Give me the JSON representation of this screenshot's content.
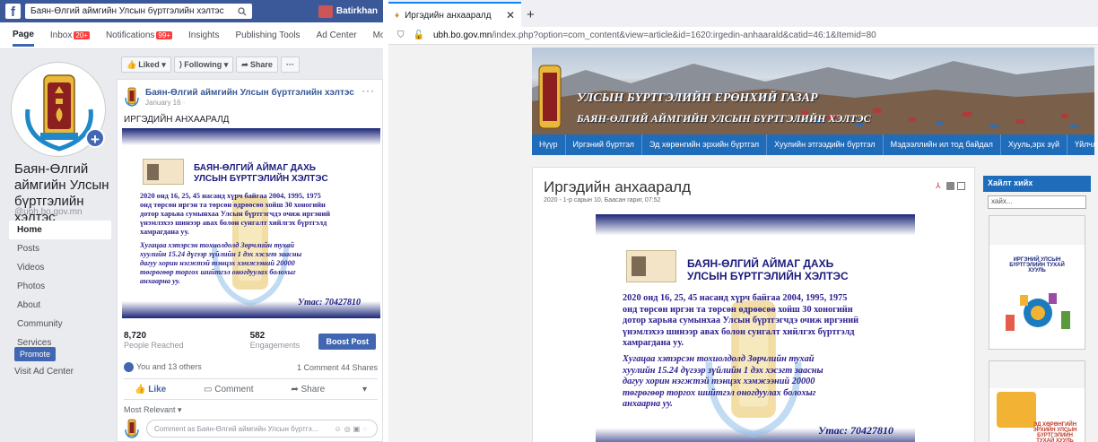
{
  "facebook": {
    "search": "Баян-Өлгий аймгийн Улсын бүртгэлийн хэлтэс",
    "user": "Batirkhan",
    "nav": [
      {
        "label": "Page"
      },
      {
        "label": "Inbox",
        "badge": "20+"
      },
      {
        "label": "Notifications",
        "badge": "99+"
      },
      {
        "label": "Insights"
      },
      {
        "label": "Publishing Tools"
      },
      {
        "label": "Ad Center"
      },
      {
        "label": "More ▾"
      }
    ],
    "page_name": "Баян-Өлгий аймгийн Улсын бүртгэлийн хэлтэс",
    "handle": "@ubh.bo.gov.mn",
    "menu": [
      "Home",
      "Posts",
      "Videos",
      "Photos",
      "About",
      "Community",
      "Services"
    ],
    "promote": "Promote",
    "visit": "Visit Ad Center",
    "actions": [
      "Liked ▾",
      "Following ▾",
      "Share",
      "···"
    ],
    "post": {
      "author": "Баян-Өлгий аймгийн Улсын бүртгэлийн хэлтэс",
      "date": "January 16 ·",
      "text": "ИРГЭДИЙН АНХААРАЛД",
      "reached": "8,720",
      "reached_label": "People Reached",
      "engagements": "582",
      "engagements_label": "Engagements",
      "boost": "Boost Post",
      "reactions": "You and 13 others",
      "comments": "1 Comment 44 Shares",
      "like": "Like",
      "comment": "Comment",
      "share": "Share",
      "most_relevant": "Most Relevant ▾",
      "comment_placeholder": "Comment as Баян-Өлгий аймгийн Улсын бүртгэ..."
    }
  },
  "banner": {
    "title1": "БАЯН-ӨЛГИЙ АЙМАГ ДАХЬ",
    "title2": "УЛСЫН БҮРТГЭЛИЙН ХЭЛТЭС",
    "body": [
      "2020 онд 16, 25, 45 насанд хүрч байгаа 2004, 1995, 1975",
      "онд төрсөн иргэн та төрсөн өдрөөсөө хойш 30 хоногийн",
      "дотор харьяа сумынхаа Улсын бүртгэгчдэ очиж иргэний",
      "үнэмлэхээ шинээр авах болон сунгалт хийлгэх бүртгэлд",
      "хамрагдана уу."
    ],
    "italic": [
      "Хугацаа хэтэрсэн тохиолдолд Зөрчлийн тухай",
      "хуулийн 15.24 дүгээр зүйлийн 1 дэх хэсэгт заасны",
      "дагуу хорин нэгжтэй тэнцэх хэмжээний 20000",
      "төгрөгөөр торгох шийтгэл оногдуулах болохыг",
      "анхаарна уу."
    ],
    "phone": "Утас: 70427810"
  },
  "browser": {
    "tab_title": "Иргэдийн анхааралд",
    "url_domain": "ubh.bo.gov.mn",
    "url_path": "/index.php?option=com_content&view=article&id=1620:irgedin-anhaarald&catid=46:1&Itemid=80",
    "header1": "УЛСЫН БҮРТГЭЛИЙН ЕРӨНХИЙ ГАЗАР",
    "header2": "БАЯН-ӨЛГИЙ АЙМГИЙН УЛСЫН БҮРТГЭЛИЙН ХЭЛТЭС",
    "nav": [
      "Нүүр",
      "Иргэний бүртгэл",
      "Эд хөрөнгийн эрхийн бүртгэл",
      "Хуулийн этгээдийн бүртгэл",
      "Мэдээллийн ил тод байдал",
      "Хууль,эрх зүй",
      "Үйлчлүүлэгчид танд"
    ],
    "article_title": "Иргэдийн анхааралд",
    "article_meta": "2020 - 1-р сарын 10, Баасан гариг, 07:52",
    "side_head": "Хайлт хийх",
    "side_search": "хайх...",
    "book1_title": "ИРГЭНИЙ УЛСЫН БҮРТГЭЛИЙН ТУХАЙ ХУУЛЬ",
    "book2_title": "ЭД ХӨРӨНГИЙН ЭРХИЙН УЛСЫН БҮРТГЭЛИЙН ТУХАЙ ХУУЛЬ"
  },
  "colors": {
    "fb_blue": "#3b5998",
    "site_blue": "#1f6cba",
    "banner_navy": "#1b2778"
  }
}
